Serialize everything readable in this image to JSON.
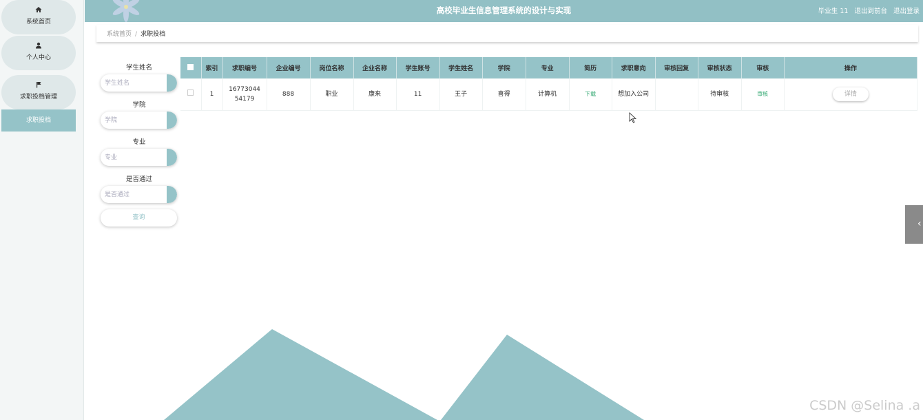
{
  "sidebar": {
    "items": [
      {
        "label": "系统首页",
        "icon": "home-icon"
      },
      {
        "label": "个人中心",
        "icon": "user-icon"
      },
      {
        "label": "求职投档管理",
        "icon": "flag-icon"
      }
    ],
    "sub_item": "求职投档"
  },
  "header": {
    "title": "高校毕业生信息管理系统的设计与实现",
    "user": "毕业生 11",
    "to_front": "退出到前台",
    "logout": "退出登录"
  },
  "breadcrumb": {
    "home": "系统首页",
    "sep": "/",
    "current": "求职投档"
  },
  "search": {
    "student_name_label": "学生姓名",
    "student_name_placeholder": "学生姓名",
    "college_label": "学院",
    "college_placeholder": "学院",
    "major_label": "专业",
    "major_placeholder": "专业",
    "passed_label": "是否通过",
    "passed_placeholder": "是否通过",
    "search_button": "查询"
  },
  "table": {
    "columns": [
      "索引",
      "求职编号",
      "企业编号",
      "岗位名称",
      "企业名称",
      "学生账号",
      "学生姓名",
      "学院",
      "专业",
      "简历",
      "求职意向",
      "审核回复",
      "审核状态",
      "审核",
      "操作"
    ],
    "rows": [
      {
        "index": "1",
        "application_no": "1677304454179",
        "company_no": "888",
        "position": "职业",
        "company_name": "康来",
        "student_account": "11",
        "student_name": "王子",
        "college": "喜得",
        "major": "计算机",
        "resume": "下载",
        "intention": "想加入公司",
        "review_reply": "",
        "review_status": "待审核",
        "review": "审核",
        "action": "详情"
      }
    ]
  },
  "colors": {
    "accent": "#95c3c8",
    "header": "#92c0c5",
    "link": "#2ea66e"
  },
  "watermark": "CSDN @Selina .a"
}
